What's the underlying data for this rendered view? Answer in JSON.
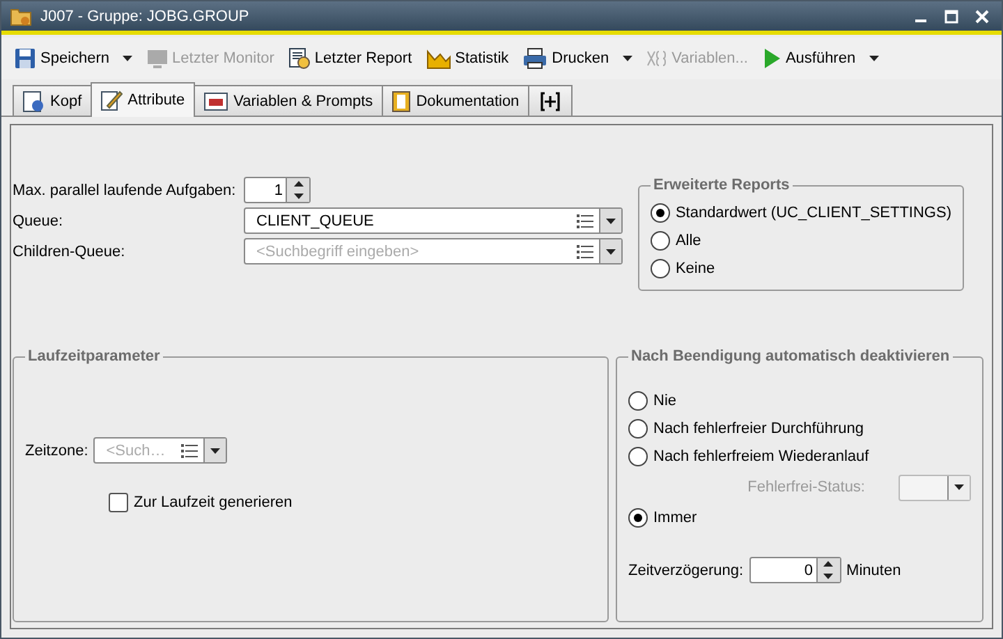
{
  "window": {
    "title": "J007 - Gruppe: JOBG.GROUP"
  },
  "toolbar": [
    {
      "label": "Speichern",
      "disabled": false,
      "menu": true
    },
    {
      "label": "Letzter Monitor",
      "disabled": true,
      "menu": false
    },
    {
      "label": "Letzter Report",
      "disabled": false,
      "menu": false
    },
    {
      "label": "Statistik",
      "disabled": false,
      "menu": false
    },
    {
      "label": "Drucken",
      "disabled": false,
      "menu": true
    },
    {
      "label": "Variablen...",
      "disabled": true,
      "menu": false
    },
    {
      "label": "Ausführen",
      "disabled": false,
      "menu": true
    }
  ],
  "tabs": [
    {
      "label": "Kopf",
      "selected": false
    },
    {
      "label": "Attribute",
      "selected": true
    },
    {
      "label": "Variablen & Prompts",
      "selected": false
    },
    {
      "label": "Dokumentation",
      "selected": false
    }
  ],
  "max_parallel": {
    "label": "Max. parallel laufende Aufgaben:",
    "value": "1"
  },
  "queue": {
    "label": "Queue:",
    "value": "CLIENT_QUEUE"
  },
  "children_queue": {
    "label": "Children-Queue:",
    "placeholder": "<Suchbegriff eingeben>"
  },
  "reports": {
    "title": "Erweiterte Reports",
    "options": [
      {
        "label": "Standardwert (UC_CLIENT_SETTINGS)",
        "selected": true
      },
      {
        "label": "Alle",
        "selected": false
      },
      {
        "label": "Keine",
        "selected": false
      }
    ]
  },
  "runtime": {
    "title": "Laufzeitparameter",
    "timezone": {
      "label": "Zeitzone:",
      "placeholder": "<Such…"
    },
    "generate": {
      "label": "Zur Laufzeit generieren",
      "checked": false
    }
  },
  "deactivate": {
    "title": "Nach Beendigung automatisch deaktivieren",
    "options": [
      {
        "label": "Nie",
        "selected": false
      },
      {
        "label": "Nach fehlerfreier Durchführung",
        "selected": false
      },
      {
        "label": "Nach fehlerfreiem Wiederanlauf",
        "selected": false
      },
      {
        "label": "Immer",
        "selected": true
      }
    ],
    "status": {
      "label": "Fehlerfrei-Status:",
      "disabled": true
    },
    "delay": {
      "label": "Zeitverzögerung:",
      "value": "0",
      "unit": "Minuten"
    }
  }
}
